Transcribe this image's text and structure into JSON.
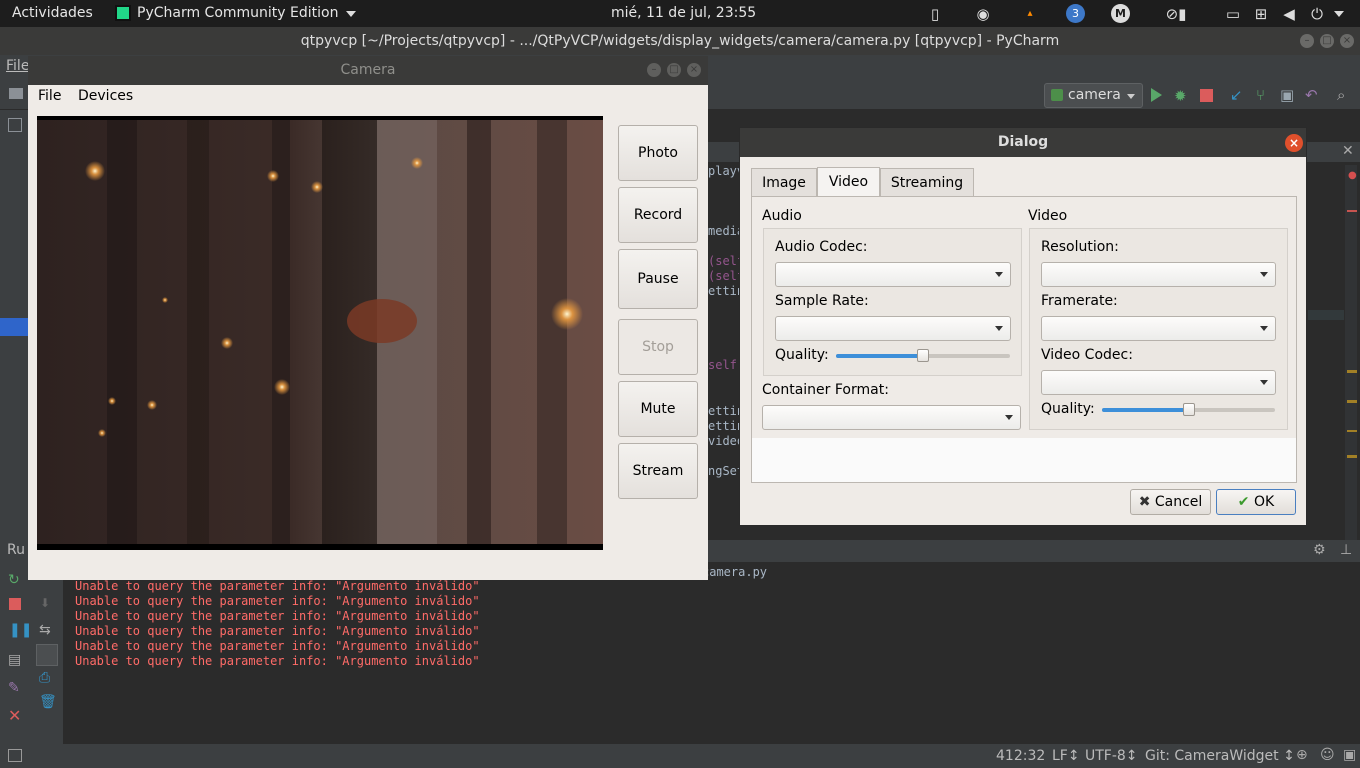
{
  "topbar": {
    "activities": "Actividades",
    "app_name": "PyCharm Community Edition",
    "clock": "mié, 11 de jul, 23:55",
    "badge": "3"
  },
  "pycharm": {
    "title": "qtpyvcp [~/Projects/qtpyvcp] - .../QtPyVCP/widgets/display_widgets/camera/camera.py [qtpyvcp] - PyCharm",
    "menu_file": "File",
    "run_config": "camera",
    "run_tab": "Ru",
    "console_header": "camera.py",
    "console_lines": [
      "Unable to query the parameter info: \"Argumento inválido\"",
      "Unable to query the parameter info: \"Argumento inválido\"",
      "Unable to query the parameter info: \"Argumento inválido\"",
      "Unable to query the parameter info: \"Argumento inválido\"",
      "Unable to query the parameter info: \"Argumento inválido\"",
      "Unable to query the parameter info: \"Argumento inválido\""
    ],
    "code_fragments": [
      "playv",
      "media",
      "(self",
      "(self",
      "etting",
      "self.",
      "etting",
      "etting",
      "video",
      "ngSet"
    ],
    "status": {
      "position": "412:32",
      "line_sep": "LF↕",
      "encoding": "UTF-8↕",
      "git": "Git: CameraWidget ↕"
    }
  },
  "camera": {
    "title": "Camera",
    "menu": [
      "File",
      "Devices"
    ],
    "buttons": {
      "photo": "Photo",
      "record": "Record",
      "pause": "Pause",
      "stop": "Stop",
      "mute": "Mute",
      "stream": "Stream"
    }
  },
  "dialog": {
    "title": "Dialog",
    "tabs": [
      "Image",
      "Video",
      "Streaming"
    ],
    "active_tab": "Video",
    "audio": {
      "group_title": "Audio",
      "codec_label": "Audio Codec:",
      "sample_rate_label": "Sample Rate:",
      "quality_label": "Quality:",
      "quality_level": 0.5
    },
    "container_label": "Container Format:",
    "video": {
      "group_title": "Video",
      "resolution_label": "Resolution:",
      "framerate_label": "Framerate:",
      "codec_label": "Video Codec:",
      "quality_label": "Quality:",
      "quality_level": 0.5
    },
    "cancel": "Cancel",
    "ok": "OK"
  }
}
